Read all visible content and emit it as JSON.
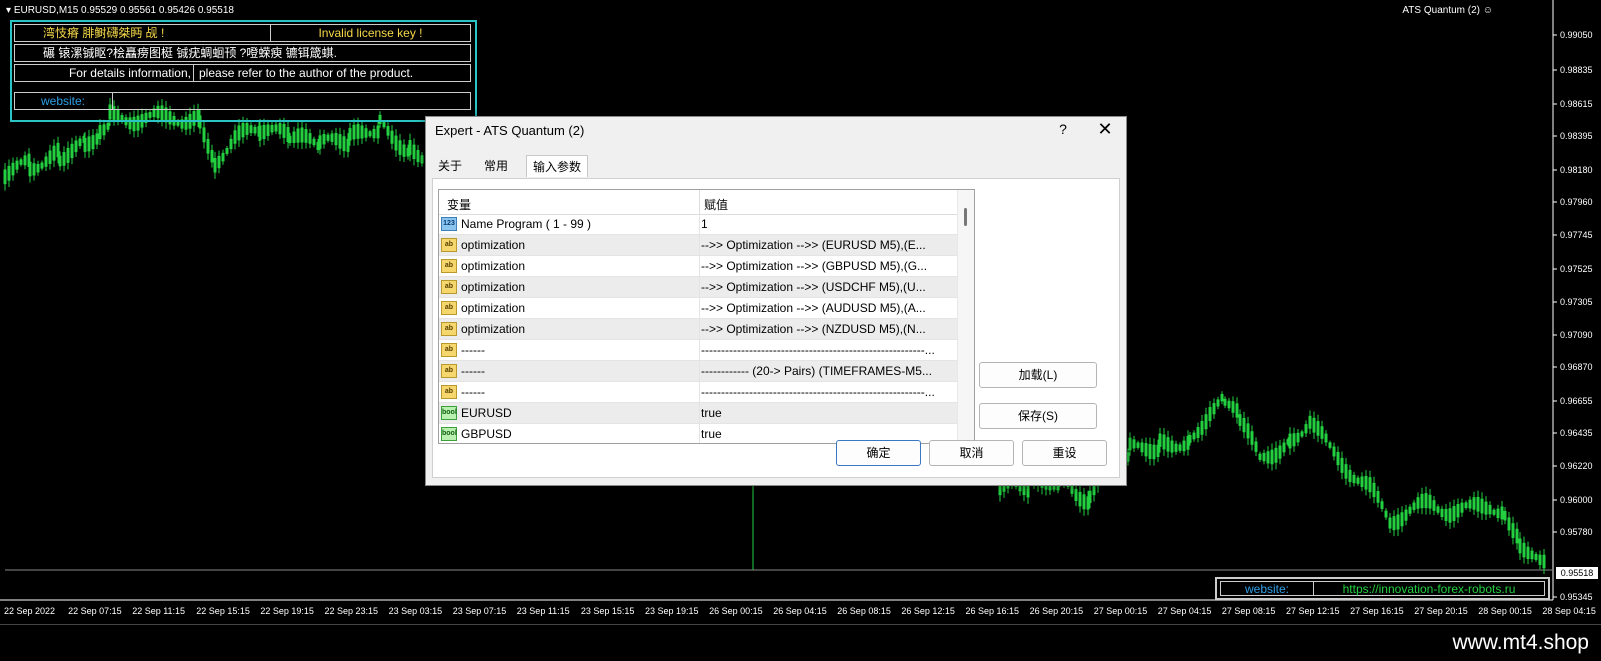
{
  "chart": {
    "symbol_info": "EURUSD,M15  0.95529 0.95561 0.95426 0.95518",
    "expert_name": "ATS Quantum (2)",
    "current_price": "0.95518",
    "price_labels": [
      "0.99050",
      "0.98835",
      "0.98615",
      "0.98395",
      "0.98180",
      "0.97960",
      "0.97745",
      "0.97525",
      "0.97305",
      "0.97090",
      "0.96870",
      "0.96655",
      "0.96435",
      "0.96220",
      "0.96000",
      "0.95780",
      "0.95345"
    ],
    "time_labels": [
      "22 Sep 2022",
      "22 Sep 07:15",
      "22 Sep 11:15",
      "22 Sep 15:15",
      "22 Sep 19:15",
      "22 Sep 23:15",
      "23 Sep 03:15",
      "23 Sep 07:15",
      "23 Sep 11:15",
      "23 Sep 15:15",
      "23 Sep 19:15",
      "26 Sep 00:15",
      "26 Sep 04:15",
      "26 Sep 08:15",
      "26 Sep 12:15",
      "26 Sep 16:15",
      "26 Sep 20:15",
      "27 Sep 00:15",
      "27 Sep 04:15",
      "27 Sep 08:15",
      "27 Sep 12:15",
      "27 Sep 16:15",
      "27 Sep 20:15",
      "28 Sep 00:15",
      "28 Sep 04:15"
    ],
    "colors": {
      "candle": "#22d040",
      "panel_border": "#2bc4c4"
    }
  },
  "license_panel": {
    "row1_left": "湾忮瘠     腓鲥礴桀眄     觇     !",
    "row1_right": "Invalid license key !",
    "row2": "碾     锿漯铖眍?桧矗痨图梃 铖疣蜩蛔顸 ?噔蝾瘐 镳铒箴蜞.",
    "row3_left": "For details information,",
    "row3_right": "please refer to the author of the product.",
    "row4_label": "website:"
  },
  "website_box": {
    "label": "website:",
    "url": "https://innovation-forex-robots.ru"
  },
  "footer": {
    "text": "www.mt4.shop"
  },
  "dialog": {
    "title": "Expert - ATS Quantum (2)",
    "help": "?",
    "close": "✕",
    "tabs": [
      "关于",
      "常用",
      "输入参数"
    ],
    "active_tab": "输入参数",
    "columns": {
      "variable": "变量",
      "value": "赋值"
    },
    "rows": [
      {
        "icon": "123",
        "name": "Name Program ( 1 - 99 )",
        "value": "1"
      },
      {
        "icon": "ab",
        "name": "optimization",
        "value": "-->> Optimization -->> (EURUSD M5),(E..."
      },
      {
        "icon": "ab",
        "name": "optimization",
        "value": "-->> Optimization -->> (GBPUSD M5),(G..."
      },
      {
        "icon": "ab",
        "name": "optimization",
        "value": "-->> Optimization -->> (USDCHF M5),(U..."
      },
      {
        "icon": "ab",
        "name": "optimization",
        "value": "-->> Optimization -->> (AUDUSD M5),(A..."
      },
      {
        "icon": "ab",
        "name": "optimization",
        "value": "-->> Optimization -->> (NZDUSD M5),(N..."
      },
      {
        "icon": "ab",
        "name": "------",
        "value": "--------------------------------------------------------..."
      },
      {
        "icon": "ab",
        "name": "------",
        "value": "------------ (20-> Pairs) (TIMEFRAMES-M5..."
      },
      {
        "icon": "ab",
        "name": "------",
        "value": "--------------------------------------------------------..."
      },
      {
        "icon": "bool",
        "name": "EURUSD",
        "value": "true"
      },
      {
        "icon": "bool",
        "name": "GBPUSD",
        "value": "true"
      }
    ],
    "buttons": {
      "load": "加载(L)",
      "save": "保存(S)",
      "ok": "确定",
      "cancel": "取消",
      "reset": "重设"
    }
  }
}
